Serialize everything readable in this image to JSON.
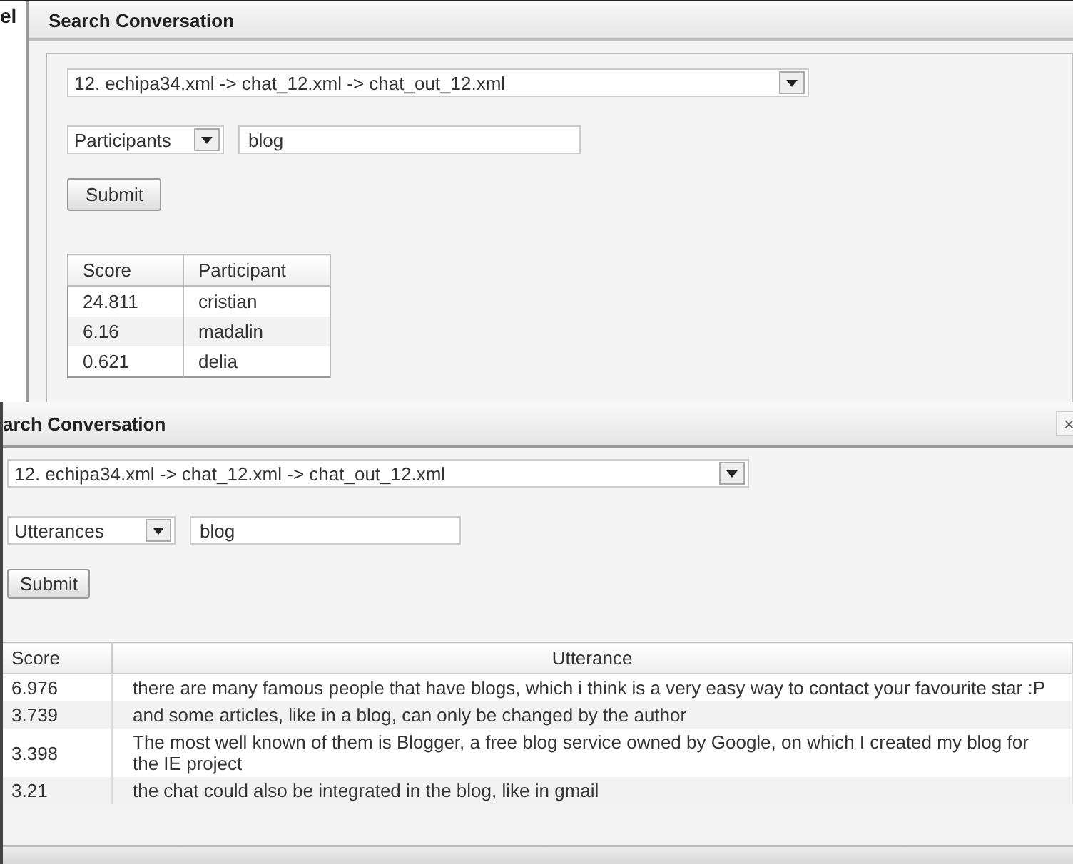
{
  "top_dialog": {
    "title": "Search Conversation",
    "side_fragment": "el",
    "conversation_select": {
      "value": "12. echipa34.xml -> chat_12.xml -> chat_out_12.xml"
    },
    "mode_select": {
      "value": "Participants"
    },
    "query_field": {
      "value": "blog"
    },
    "submit_button": "Submit",
    "table": {
      "columns": [
        "Score",
        "Participant"
      ],
      "rows": [
        {
          "score": "24.811",
          "text": "cristian"
        },
        {
          "score": "6.16",
          "text": "madalin"
        },
        {
          "score": "0.621",
          "text": "delia"
        }
      ]
    }
  },
  "bottom_dialog": {
    "title": "arch Conversation",
    "close": "×",
    "conversation_select": {
      "value": "12. echipa34.xml -> chat_12.xml -> chat_out_12.xml"
    },
    "mode_select": {
      "value": "Utterances"
    },
    "query_field": {
      "value": "blog"
    },
    "submit_button": "Submit",
    "table": {
      "columns": [
        "Score",
        "Utterance"
      ],
      "rows": [
        {
          "score": "6.976",
          "text": "there are many famous people that have blogs, which i think is a very easy way to contact your favourite star :P"
        },
        {
          "score": "3.739",
          "text": "and some articles, like in a blog, can only be changed by the author"
        },
        {
          "score": "3.398",
          "text": "The most well known of them is Blogger, a free blog service owned by Google, on which I created my blog for the IE project"
        },
        {
          "score": "3.21",
          "text": "the chat could also be integrated in the blog, like in gmail"
        }
      ]
    }
  }
}
